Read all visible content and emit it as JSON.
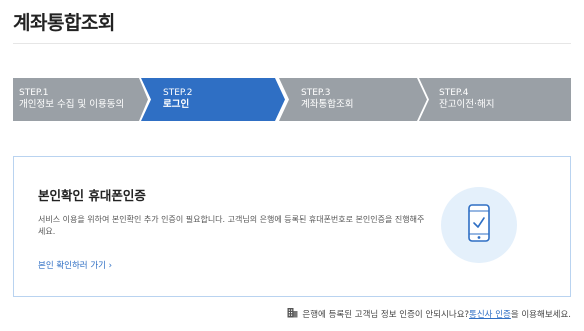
{
  "page": {
    "title": "계좌통합조회"
  },
  "steps": [
    {
      "num": "STEP.1",
      "label": "개인정보 수집 및 이용동의",
      "state": "done"
    },
    {
      "num": "STEP.2",
      "label": "로그인",
      "state": "active"
    },
    {
      "num": "STEP.3",
      "label": "계좌통합조회",
      "state": "pending"
    },
    {
      "num": "STEP.4",
      "label": "잔고이전·해지",
      "state": "pending"
    }
  ],
  "colors": {
    "active": "#2f6fc4",
    "inactive": "#9aa0a6",
    "link": "#2f6fc4",
    "card_border": "#b9d3f0",
    "icon_bg": "#e4f0fb"
  },
  "card": {
    "title": "본인확인 휴대폰인증",
    "desc": "서비스 이용을 위하여 본인확인 추가 인증이 필요합니다. 고객님의 은행에 등록된 휴대폰번호로 본인인증을 진행해주세요.",
    "link": "본인 확인하러 가기",
    "icon": "phone-check-icon"
  },
  "footer": {
    "text_before": "은행에 등록된 고객님 정보 인증이 안되시나요? ",
    "link": "통신사 인증",
    "text_after": "을 이용해보세요.",
    "icon": "building-icon"
  }
}
